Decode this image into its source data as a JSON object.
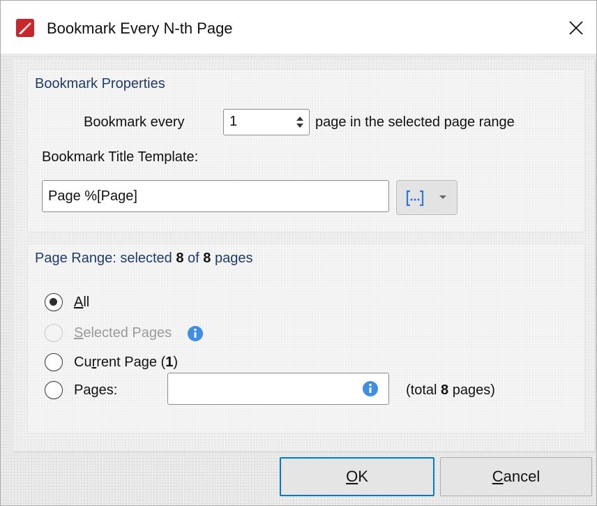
{
  "window": {
    "title": "Bookmark Every N-th Page",
    "app_icon": "pdf-editor-logo-icon",
    "close_icon": "close-icon"
  },
  "bookmark_properties": {
    "header": "Bookmark Properties",
    "every_label": "Bookmark every",
    "every_value": "1",
    "every_suffix": "page in the selected page range",
    "template_label": "Bookmark Title Template:",
    "template_value": "Page %[Page]",
    "macro_icon": "insert-macro-icon",
    "dropdown_icon": "chevron-down-icon"
  },
  "page_range": {
    "header_prefix": "Page Range: selected ",
    "selected_count": "8",
    "header_middle": " of ",
    "total_count": "8",
    "header_suffix": " pages",
    "options": {
      "all": {
        "accel": "A",
        "rest": "ll",
        "checked": true
      },
      "selected_pages": {
        "pre": "",
        "accel": "S",
        "rest": "elected Pages",
        "disabled": true
      },
      "current_page": {
        "pre": "Cu",
        "accel": "r",
        "rest": "rent Page (",
        "number": "1",
        "close": ")"
      },
      "pages": {
        "pre": "Pa",
        "accel": "g",
        "rest": "es:"
      }
    },
    "pages_input_value": "",
    "total_prefix": "(total ",
    "total_value": "8",
    "total_suffix": " pages)"
  },
  "buttons": {
    "ok_accel": "O",
    "ok_rest": "K",
    "cancel_accel": "C",
    "cancel_rest": "ancel"
  },
  "colors": {
    "accent": "#0078d7",
    "info_blue": "#3f8ee6",
    "group_header_text": "#1f3b6e",
    "logo_red": "#c7282e"
  }
}
